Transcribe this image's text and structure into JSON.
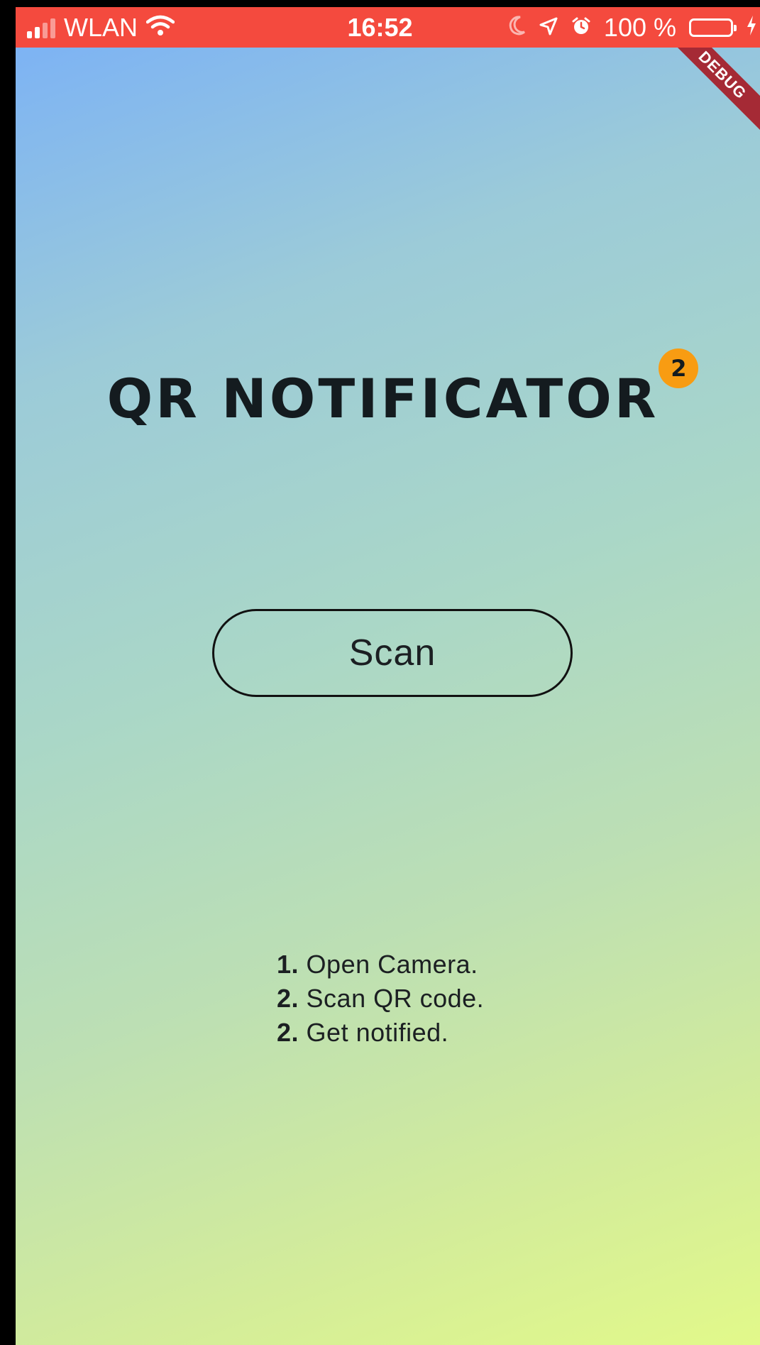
{
  "status_bar": {
    "carrier": "WLAN",
    "time": "16:52",
    "battery": "100 %",
    "battery_level": 1.0,
    "icons": [
      "signal-icon",
      "wifi-icon",
      "moon-icon",
      "location-arrow-icon",
      "alarm-icon",
      "battery-icon",
      "charging-bolt-icon"
    ],
    "background_color": "#f44a3e"
  },
  "debug_banner": "DEBUG",
  "app": {
    "title": "QR NOTIFICATOR",
    "badge": "2",
    "badge_color": "#f89c12",
    "scan_button_label": "Scan",
    "steps": [
      {
        "num": "1.",
        "text": "Open Camera."
      },
      {
        "num": "2.",
        "text": "Scan QR code."
      },
      {
        "num": "2.",
        "text": "Get notified."
      }
    ],
    "gradient_colors": [
      "#7db3f4",
      "#aad7c7",
      "#e2f98a"
    ]
  }
}
